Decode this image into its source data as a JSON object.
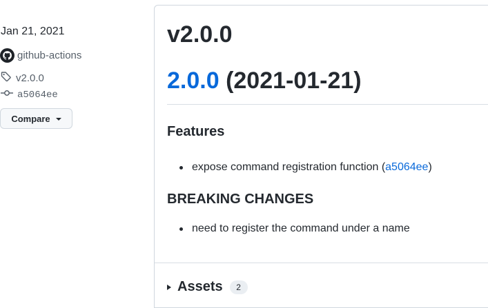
{
  "sidebar": {
    "date": "Jan 21, 2021",
    "author": "github-actions",
    "tag": "v2.0.0",
    "commit": "a5064ee",
    "compare_label": "Compare"
  },
  "release": {
    "title": "v2.0.0",
    "version_link": "2.0.0",
    "version_date": " (2021-01-21)",
    "sections": [
      {
        "heading": "Features",
        "items": [
          {
            "text_before": "expose command registration function (",
            "link": "a5064ee",
            "text_after": ")"
          }
        ]
      },
      {
        "heading": "BREAKING CHANGES",
        "items": [
          {
            "text_before": "need to register the command under a name",
            "link": "",
            "text_after": ""
          }
        ]
      }
    ],
    "assets": {
      "label": "Assets",
      "count": "2"
    }
  },
  "colors": {
    "link": "#0969da",
    "text": "#24292f",
    "muted": "#57606a",
    "border": "#d0d7de"
  },
  "icons": {
    "avatar": "github-mark-icon",
    "tag": "tag-icon",
    "commit": "git-commit-icon",
    "dropdown": "triangle-down-icon",
    "assets_toggle": "triangle-right-icon"
  }
}
